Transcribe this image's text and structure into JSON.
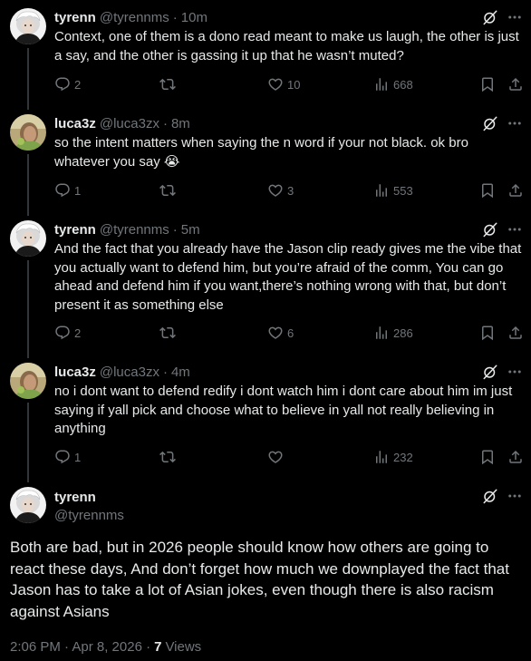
{
  "replies": [
    {
      "name": "tyrenn",
      "handle": "@tyrennms",
      "sep": "·",
      "time": "10m",
      "text": "Context, one of them is a dono read meant to make us laugh, the other is just a say, and the other is gassing it up that he wasn’t muted?",
      "replies": "2",
      "reposts": "",
      "likes": "10",
      "views": "668",
      "avatar": "white-hair-avatar"
    },
    {
      "name": "luca3z",
      "handle": "@luca3zx",
      "sep": "·",
      "time": "8m",
      "text": "so the intent matters when saying the n word if your not black. ok bro whatever you say 😭",
      "replies": "1",
      "reposts": "",
      "likes": "3",
      "views": "553",
      "avatar": "photo-avatar"
    },
    {
      "name": "tyrenn",
      "handle": "@tyrennms",
      "sep": "·",
      "time": "5m",
      "text": "And the fact that you already have the Jason clip ready gives me the vibe that you actually want to defend him, but you’re afraid of the comm, You can go ahead and defend him if you want,there’s nothing wrong with that, but don’t present it as something else",
      "replies": "2",
      "reposts": "",
      "likes": "6",
      "views": "286",
      "avatar": "white-hair-avatar"
    },
    {
      "name": "luca3z",
      "handle": "@luca3zx",
      "sep": "·",
      "time": "4m",
      "text": "no i dont want to defend redify i dont watch him i dont care about him im just saying if yall pick and choose what to believe in yall not really believing in anything",
      "replies": "1",
      "reposts": "",
      "likes": "",
      "views": "232",
      "avatar": "photo-avatar"
    }
  ],
  "main": {
    "name": "tyrenn",
    "handle": "@tyrennms",
    "text": "Both are bad, but in 2026 people should know how others are going to react these days, And don’t forget how much we downplayed the fact that Jason has to take a lot of Asian jokes, even though there is also racism against Asians",
    "timestamp": "2:06 PM · Apr 8, 2026 ·",
    "views_count": "7",
    "views_label": "Views"
  },
  "colors": {
    "background": "#000000",
    "text": "#e7e9ea",
    "muted": "#71767b",
    "thread_line": "#333639"
  },
  "icons": [
    "reply-icon",
    "repost-icon",
    "like-icon",
    "views-icon",
    "bookmark-icon",
    "share-icon",
    "grok-icon",
    "more-icon"
  ]
}
